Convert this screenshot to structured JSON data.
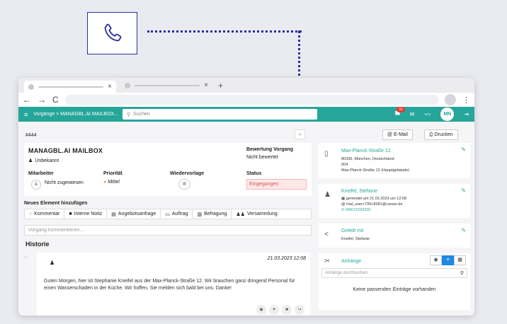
{
  "icons": {
    "phone": "phone-icon",
    "menu": "hamburger-icon"
  },
  "browser": {
    "tabs": [
      {
        "close": "×"
      },
      {
        "close": "×"
      }
    ],
    "new_tab": "+",
    "nav": {
      "back": "←",
      "forward": "→",
      "reload": "C"
    },
    "kebab": "⋮"
  },
  "header": {
    "breadcrumb": "Vorgänge > MANAGBL.AI MAILBOX...",
    "search_placeholder": "Suchen",
    "notifications_count": "31",
    "avatar_initials": "MN"
  },
  "case": {
    "number": "#444",
    "title": "MANAGBL.AI MAILBOX",
    "contact": "Unbekannt",
    "rating_label": "Bewertung Vorgang",
    "rating_value": "Nicht bewertet",
    "columns": {
      "employee_label": "Mitarbeiter",
      "employee_value": "Nicht zugewiesen",
      "priority_label": "Priorität",
      "priority_value": "Mittel",
      "followup_label": "Wiedervorlage",
      "status_label": "Status",
      "status_value": "Eingegangen"
    }
  },
  "new_element": {
    "title": "Neues Element hinzufügen",
    "actions": [
      "Kommentar",
      "Interne Notiz",
      "Angebotsanfrage",
      "Auftrag",
      "Befragung",
      "Versammlung"
    ]
  },
  "comment_placeholder": "Vorgang kommentieren...",
  "history": {
    "title": "Historie",
    "entry": {
      "date": "21.03.2023 12:08",
      "text": "Guten Morgen, hier ist Stephanie Kneifel aus der Max-Planck-Straße 12. Wir brauchen ganz dringend Personal für einen Wasserschaden in der Küche. Wir hoffen, Sie melden sich bald bei uns. Danke!"
    }
  },
  "right_panel": {
    "email_button": "E-Mail",
    "print_button": "Drucken",
    "address": {
      "street": "Max-Planck-Straße 12",
      "city": "80336, München, Deutschland",
      "unit": "004",
      "building": "Max-Planck-Straße 12 (Hauptgebäude)"
    },
    "reporter": {
      "name": "Kneifel, Stefanie",
      "reported": "gemeldet am 21.03.2023 um 12:08",
      "email": "trial_user+735+8381@casavi.de",
      "phone": "089/21543336"
    },
    "shared": {
      "title": "Geteilt mit",
      "name": "Kneifel, Stefanie"
    },
    "attachments": {
      "title": "Anhänge",
      "search_placeholder": "Anhänge durchsuchen",
      "empty": "Keine passenden Einträge vorhanden"
    }
  },
  "colors": {
    "accent": "#26a69a",
    "icon_frame": "#2a2f9c",
    "status": "#d9534f"
  }
}
